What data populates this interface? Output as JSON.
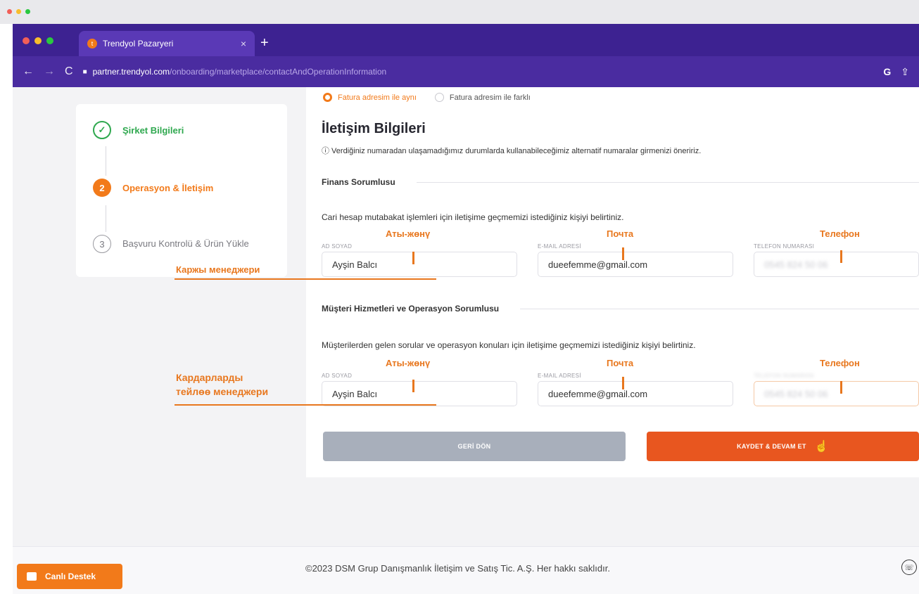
{
  "browser": {
    "tab_title": "Trendyol Pazaryeri",
    "tab_close": "×",
    "new_tab": "+",
    "url_host": "partner.trendyol.com",
    "url_path": "/onboarding/marketplace/contactAndOperationInformation"
  },
  "stepper": {
    "steps": [
      {
        "label": "Şirket Bilgileri",
        "status": "done"
      },
      {
        "number": "2",
        "label": "Operasyon & İletişim",
        "status": "active"
      },
      {
        "number": "3",
        "label": "Başvuru Kontrolü & Ürün Yükle",
        "status": "pending"
      }
    ]
  },
  "form": {
    "address_options": [
      "Fatura adresim ile aynı",
      "Fatura adresim ile farklı"
    ],
    "section_title": "İletişim Bilgileri",
    "info_text": "ⓘ Verdiğiniz numaradan ulaşamadığımız durumlarda kullanabileceğimiz alternatif numaralar girmenizi öneririz.",
    "finance": {
      "title": "Finans Sorumlusu",
      "desc": "Cari hesap mutabakat işlemleri için iletişime geçmemizi istediğiniz kişiyi belirtiniz.",
      "name_label": "AD SOYAD",
      "name_value": "Ayşin Balcı",
      "email_label": "E-MAIL ADRESİ",
      "email_value": "dueefemme@gmail.com",
      "phone_label": "TELEFON NUMARASI",
      "phone_value": "0545 824 50 06"
    },
    "support": {
      "title": "Müşteri Hizmetleri ve Operasyon Sorumlusu",
      "desc": "Müşterilerden gelen sorular ve operasyon konuları için iletişime geçmemizi istediğiniz kişiyi belirtiniz.",
      "name_label": "AD SOYAD",
      "name_value": "Ayşin Balcı",
      "email_label": "E-MAIL ADRESİ",
      "email_value": "dueefemme@gmail.com",
      "phone_label": "TELEFON NUMARASI",
      "phone_value": "0545 824 50 06"
    },
    "back_button": "GERİ DÖN",
    "next_button": "KAYDET & DEVAM ET"
  },
  "footer": {
    "copyright": "©2023 DSM Grup Danışmanlık İletişim ve Satış Tic. A.Ş. Her hakkı saklıdır.",
    "support_button": "Canlı Destek"
  },
  "annotations": {
    "name": "Аты-жөнү",
    "email": "Почта",
    "phone": "Телефон",
    "finance_manager": "Каржы менеджери",
    "service_manager_line1": "Кардарларды",
    "service_manager_line2": "тейлөө менеджери"
  },
  "colors": {
    "brand_orange": "#f27a1a",
    "primary_button": "#e8561f",
    "chrome_purple": "#4a2ca0",
    "annotation": "#e8771e"
  }
}
